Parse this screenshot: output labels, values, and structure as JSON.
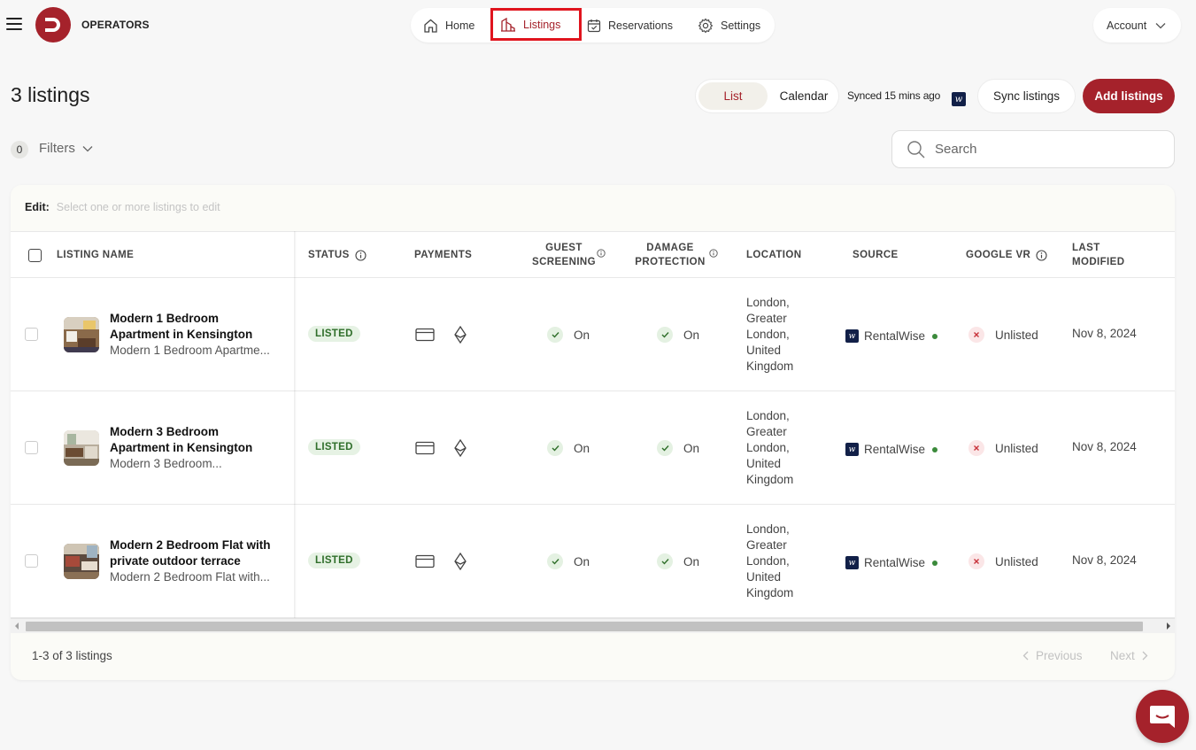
{
  "header": {
    "brand": "OPERATORS",
    "nav": [
      {
        "label": "Home",
        "icon": "home-icon"
      },
      {
        "label": "Listings",
        "icon": "listings-icon",
        "active": true
      },
      {
        "label": "Reservations",
        "icon": "calendar-icon"
      },
      {
        "label": "Settings",
        "icon": "gear-icon"
      }
    ],
    "account_label": "Account"
  },
  "page": {
    "title": "3 listings",
    "view_toggle": {
      "list": "List",
      "calendar": "Calendar",
      "selected": "List"
    },
    "synced_text": "Synced 15 mins ago",
    "sync_button": "Sync listings",
    "add_button": "Add listings",
    "filter_count": "0",
    "filters_label": "Filters",
    "search_placeholder": "Search"
  },
  "edit_bar": {
    "label": "Edit:",
    "hint": "Select one or more listings to edit"
  },
  "table": {
    "columns": {
      "listing_name": "LISTING NAME",
      "status": "STATUS",
      "payments": "PAYMENTS",
      "guest_screening_1": "GUEST",
      "guest_screening_2": "SCREENING",
      "damage_protection_1": "DAMAGE",
      "damage_protection_2": "PROTECTION",
      "location": "LOCATION",
      "source": "SOURCE",
      "google_vr": "GOOGLE VR",
      "last_modified_1": "LAST",
      "last_modified_2": "MODIFIED"
    },
    "rows": [
      {
        "title_1": "Modern 1 Bedroom",
        "title_2": "Apartment in Kensington",
        "subtitle": "Modern 1 Bedroom Apartme...",
        "status": "LISTED",
        "guest_screening": "On",
        "damage_protection": "On",
        "location": [
          "London,",
          "Greater",
          "London,",
          "United",
          "Kingdom"
        ],
        "source": "RentalWise",
        "google_vr": "Unlisted",
        "last_modified": "Nov 8, 2024"
      },
      {
        "title_1": "Modern 3 Bedroom",
        "title_2": "Apartment in Kensington",
        "subtitle": "Modern 3 Bedroom...",
        "status": "LISTED",
        "guest_screening": "On",
        "damage_protection": "On",
        "location": [
          "London,",
          "Greater",
          "London,",
          "United",
          "Kingdom"
        ],
        "source": "RentalWise",
        "google_vr": "Unlisted",
        "last_modified": "Nov 8, 2024"
      },
      {
        "title_1": "Modern 2 Bedroom Flat with",
        "title_2": "private outdoor terrace",
        "subtitle": "Modern 2 Bedroom Flat with...",
        "status": "LISTED",
        "guest_screening": "On",
        "damage_protection": "On",
        "location": [
          "London,",
          "Greater",
          "London,",
          "United",
          "Kingdom"
        ],
        "source": "RentalWise",
        "google_vr": "Unlisted",
        "last_modified": "Nov 8, 2024"
      }
    ]
  },
  "footer": {
    "count": "1-3 of 3 listings",
    "previous": "Previous",
    "next": "Next"
  },
  "colors": {
    "brand": "#a5222b",
    "highlight_box": "#e0141e",
    "listed_pill_bg": "#e6f2e4",
    "listed_pill_text": "#2f6e2a",
    "source_logo": "#122048"
  }
}
